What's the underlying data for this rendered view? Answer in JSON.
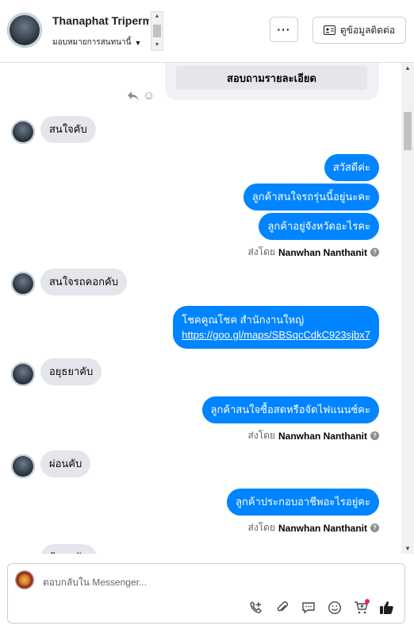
{
  "header": {
    "name": "Thanaphat Tripermpool",
    "subtitle": "มอบหมายการสนทนานี้",
    "more_label": "···",
    "contact_label": "ดูข้อมูลติดต่อ"
  },
  "chat": {
    "card_button_label": "สอบถามรายละเอียด",
    "messages": [
      {
        "side": "in",
        "text": "สนใจคับ"
      },
      {
        "side": "out",
        "text": "สวัสดีค่ะ"
      },
      {
        "side": "out",
        "text": "ลูกค้าสนใจรถรุ่นนี้อยู่นะคะ"
      },
      {
        "side": "out",
        "text": "ลูกค้าอยู่จังหวัดอะไรคะ"
      },
      {
        "side": "in",
        "text": "สนใจรถคอกคับ"
      },
      {
        "side": "out",
        "text": "โชคคูณโชค สำนักงานใหญ่",
        "link": "https://goo.gl/maps/SBSqcCdkC923sjbx7"
      },
      {
        "side": "in",
        "text": "อยุธยาคับ"
      },
      {
        "side": "out",
        "text": "ลูกค้าสนใจซื้อสดหรือจัดไฟแนนซ์คะ"
      },
      {
        "side": "in",
        "text": "ผ่อนคับ"
      },
      {
        "side": "out",
        "text": "ลูกค้าประกอบอาชีพอะไรอยู่คะ"
      }
    ],
    "sent_by_prefix": "ส่งโดย",
    "sent_by_name": "Nanwhan Nanthanit",
    "partial_message": "ผ้าอนคับ"
  },
  "composer": {
    "placeholder": "ตอบกลับใน Messenger..."
  },
  "colors": {
    "outgoing": "#0084ff",
    "incoming": "#e4e6eb",
    "badge": "#f02849"
  }
}
